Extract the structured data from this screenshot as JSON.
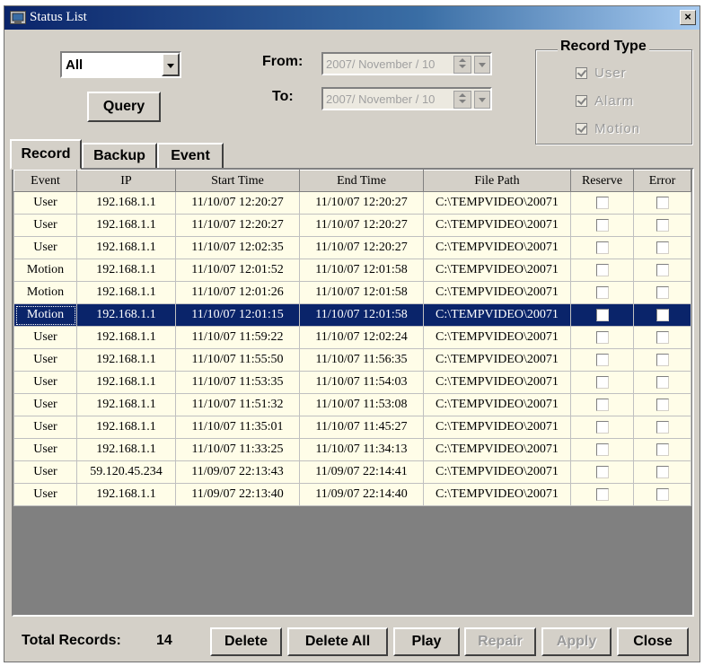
{
  "window": {
    "title": "Status List",
    "close_glyph": "×"
  },
  "filter": {
    "event_select": "All",
    "query_label": "Query",
    "from_label": "From:",
    "to_label": "To:",
    "from_value": "2007/ November / 10",
    "to_value": "2007/ November / 10"
  },
  "record_type": {
    "title": "Record Type",
    "options": [
      {
        "label": "User",
        "checked": true
      },
      {
        "label": "Alarm",
        "checked": true
      },
      {
        "label": "Motion",
        "checked": true
      }
    ]
  },
  "tabs": [
    "Record",
    "Backup",
    "Event"
  ],
  "table": {
    "columns": [
      "Event",
      "IP",
      "Start Time",
      "End Time",
      "File Path",
      "Reserve",
      "Error"
    ],
    "rows": [
      {
        "event": "User",
        "ip": "192.168.1.1",
        "start": "11/10/07 12:20:27",
        "end": "11/10/07 12:20:27",
        "path": "C:\\TEMPVIDEO\\20071"
      },
      {
        "event": "User",
        "ip": "192.168.1.1",
        "start": "11/10/07 12:20:27",
        "end": "11/10/07 12:20:27",
        "path": "C:\\TEMPVIDEO\\20071"
      },
      {
        "event": "User",
        "ip": "192.168.1.1",
        "start": "11/10/07 12:02:35",
        "end": "11/10/07 12:20:27",
        "path": "C:\\TEMPVIDEO\\20071"
      },
      {
        "event": "Motion",
        "ip": "192.168.1.1",
        "start": "11/10/07 12:01:52",
        "end": "11/10/07 12:01:58",
        "path": "C:\\TEMPVIDEO\\20071"
      },
      {
        "event": "Motion",
        "ip": "192.168.1.1",
        "start": "11/10/07 12:01:26",
        "end": "11/10/07 12:01:58",
        "path": "C:\\TEMPVIDEO\\20071"
      },
      {
        "event": "Motion",
        "ip": "192.168.1.1",
        "start": "11/10/07 12:01:15",
        "end": "11/10/07 12:01:58",
        "path": "C:\\TEMPVIDEO\\20071",
        "selected": true
      },
      {
        "event": "User",
        "ip": "192.168.1.1",
        "start": "11/10/07 11:59:22",
        "end": "11/10/07 12:02:24",
        "path": "C:\\TEMPVIDEO\\20071"
      },
      {
        "event": "User",
        "ip": "192.168.1.1",
        "start": "11/10/07 11:55:50",
        "end": "11/10/07 11:56:35",
        "path": "C:\\TEMPVIDEO\\20071"
      },
      {
        "event": "User",
        "ip": "192.168.1.1",
        "start": "11/10/07 11:53:35",
        "end": "11/10/07 11:54:03",
        "path": "C:\\TEMPVIDEO\\20071"
      },
      {
        "event": "User",
        "ip": "192.168.1.1",
        "start": "11/10/07 11:51:32",
        "end": "11/10/07 11:53:08",
        "path": "C:\\TEMPVIDEO\\20071"
      },
      {
        "event": "User",
        "ip": "192.168.1.1",
        "start": "11/10/07 11:35:01",
        "end": "11/10/07 11:45:27",
        "path": "C:\\TEMPVIDEO\\20071"
      },
      {
        "event": "User",
        "ip": "192.168.1.1",
        "start": "11/10/07 11:33:25",
        "end": "11/10/07 11:34:13",
        "path": "C:\\TEMPVIDEO\\20071"
      },
      {
        "event": "User",
        "ip": "59.120.45.234",
        "start": "11/09/07 22:13:43",
        "end": "11/09/07 22:14:41",
        "path": "C:\\TEMPVIDEO\\20071"
      },
      {
        "event": "User",
        "ip": "192.168.1.1",
        "start": "11/09/07 22:13:40",
        "end": "11/09/07 22:14:40",
        "path": "C:\\TEMPVIDEO\\20071"
      }
    ]
  },
  "footer": {
    "total_label": "Total Records:",
    "total_value": "14",
    "buttons": [
      {
        "label": "Delete",
        "enabled": true
      },
      {
        "label": "Delete All",
        "enabled": true
      },
      {
        "label": "Play",
        "enabled": true
      },
      {
        "label": "Repair",
        "enabled": false
      },
      {
        "label": "Apply",
        "enabled": false
      },
      {
        "label": "Close",
        "enabled": true
      }
    ]
  },
  "colors": {
    "face": "#d4d0c8",
    "title_bar": "#0a246a",
    "row_bg": "#fffde8",
    "selection": "#0a246a",
    "empty_area": "#808080"
  }
}
